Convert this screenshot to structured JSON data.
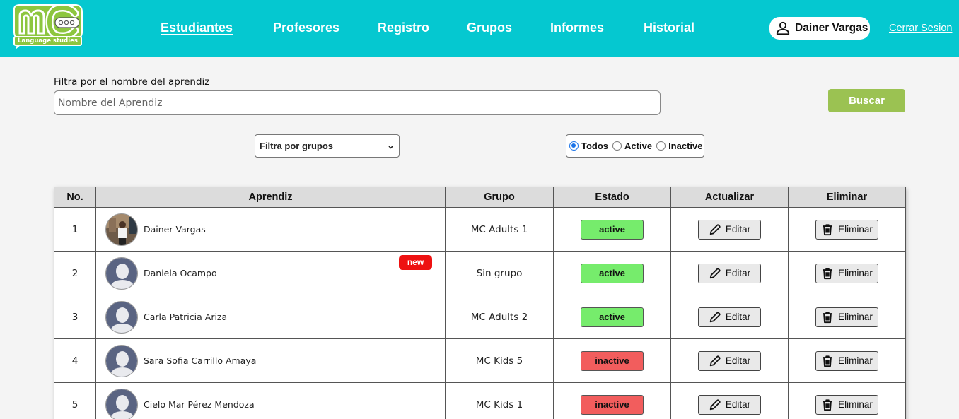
{
  "header": {
    "logo_text": "MC",
    "logo_subtitle": "Language studies",
    "nav": [
      {
        "label": "Estudiantes",
        "active": true
      },
      {
        "label": "Profesores",
        "active": false
      },
      {
        "label": "Registro",
        "active": false
      },
      {
        "label": "Grupos",
        "active": false
      },
      {
        "label": "Informes",
        "active": false
      },
      {
        "label": "Historial",
        "active": false
      }
    ],
    "user_name": "Dainer Vargas",
    "logout_label": "Cerrar Sesion",
    "bg_color": "#05c8d0"
  },
  "filters": {
    "name_label": "Filtra por el nombre del aprendiz",
    "name_placeholder": "Nombre del Aprendiz",
    "name_value": "",
    "search_label": "Buscar",
    "group_select_value": "Filtra por grupos",
    "status_options": [
      {
        "label": "Todos",
        "checked": true
      },
      {
        "label": "Active",
        "checked": false
      },
      {
        "label": "Inactive",
        "checked": false
      }
    ]
  },
  "table": {
    "headers": [
      "No.",
      "Aprendiz",
      "Grupo",
      "Estado",
      "Actualizar",
      "Eliminar"
    ],
    "edit_label": "Editar",
    "delete_label": "Eliminar",
    "new_badge_label": "new",
    "rows": [
      {
        "no": "1",
        "name": "Dainer Vargas",
        "group": "MC Adults 1",
        "status": "active",
        "avatar": "photo",
        "is_new": false
      },
      {
        "no": "2",
        "name": "Daniela Ocampo",
        "group": "Sin grupo",
        "status": "active",
        "avatar": "default",
        "is_new": true
      },
      {
        "no": "3",
        "name": "Carla Patricia Ariza",
        "group": "MC Adults 2",
        "status": "active",
        "avatar": "default",
        "is_new": false
      },
      {
        "no": "4",
        "name": "Sara Sofia Carrillo Amaya",
        "group": "MC Kids 5",
        "status": "inactive",
        "avatar": "default",
        "is_new": false
      },
      {
        "no": "5",
        "name": "Cielo Mar Pérez Mendoza",
        "group": "MC Kids 1",
        "status": "inactive",
        "avatar": "default",
        "is_new": false
      }
    ]
  },
  "colors": {
    "accent_green": "#9bc252",
    "status_active": "#76ec6c",
    "status_inactive": "#f25d5d",
    "badge_new": "#ee1111"
  }
}
